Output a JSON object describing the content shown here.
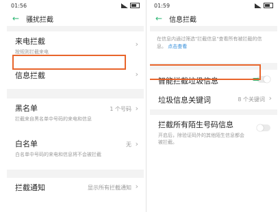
{
  "left": {
    "status_time": "01:56",
    "title": "骚扰拦截",
    "items": [
      {
        "label": "来电拦截",
        "sub": "按规则拦截来电"
      },
      {
        "label": "信息拦截"
      },
      {
        "label": "黑名单",
        "sub": "拦截来自黑名单中号码的来电和信息",
        "value": "1 个号码"
      },
      {
        "label": "白名单",
        "sub": "白名单中号码的来电和信息将不会被拦截",
        "value": "无"
      },
      {
        "label": "拦截通知",
        "value": "显示所有拦截通知"
      }
    ]
  },
  "right": {
    "status_time": "01:59",
    "title": "信息拦截",
    "info_text": "在信息内通过筛选\"拦截信息\"查看所有被拦截的信息。",
    "info_link": "点击查看",
    "items": [
      {
        "label": "智能拦截垃圾信息",
        "toggle": true
      },
      {
        "label": "垃圾信息关键词",
        "value": "8 个关键词"
      },
      {
        "label": "拦截所有陌生号码信息",
        "sub": "开启后，除验证码外的其他陌生信息都会被拦截。",
        "toggle": false
      }
    ]
  },
  "colors": {
    "accent": "#2bb673",
    "highlight": "#e8642a",
    "link": "#2e8ad8"
  }
}
